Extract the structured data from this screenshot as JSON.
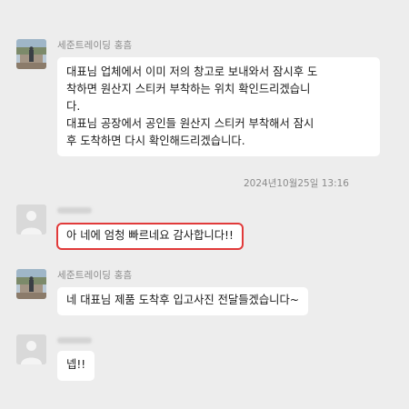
{
  "messages": [
    {
      "sender": "세준트레이딩 홍흠",
      "avatar": "photo-avatar",
      "paragraphs": [
        "대표님 업체에서 이미 저의 창고로 보내와서 잠시후 도\n착하면 원산지 스티커 부착하는 위치 확인드리겠습니\n다.",
        "대표님 공장에서 공인들 원산지 스티커 부착해서 잠시\n후 도착하면 다시 확인해드리겠습니다."
      ]
    },
    {
      "sender": "",
      "avatar": "default-user-icon",
      "text": "아 네에 엄청 빠르네요 감사합니다!!",
      "highlighted": true
    },
    {
      "sender": "세준트레이딩 홍흠",
      "avatar": "photo-avatar",
      "text": "네 대표님 제품 도착후 입고사진 전달들겠습니다~"
    },
    {
      "sender": "",
      "avatar": "default-user-icon",
      "text": "넵!!"
    }
  ],
  "timestamp": "2024년10월25일 13:16",
  "colors": {
    "background": "#ededed",
    "bubble": "#ffffff",
    "highlight_border": "#e13a3a",
    "meta_text": "#8a8a8a"
  }
}
